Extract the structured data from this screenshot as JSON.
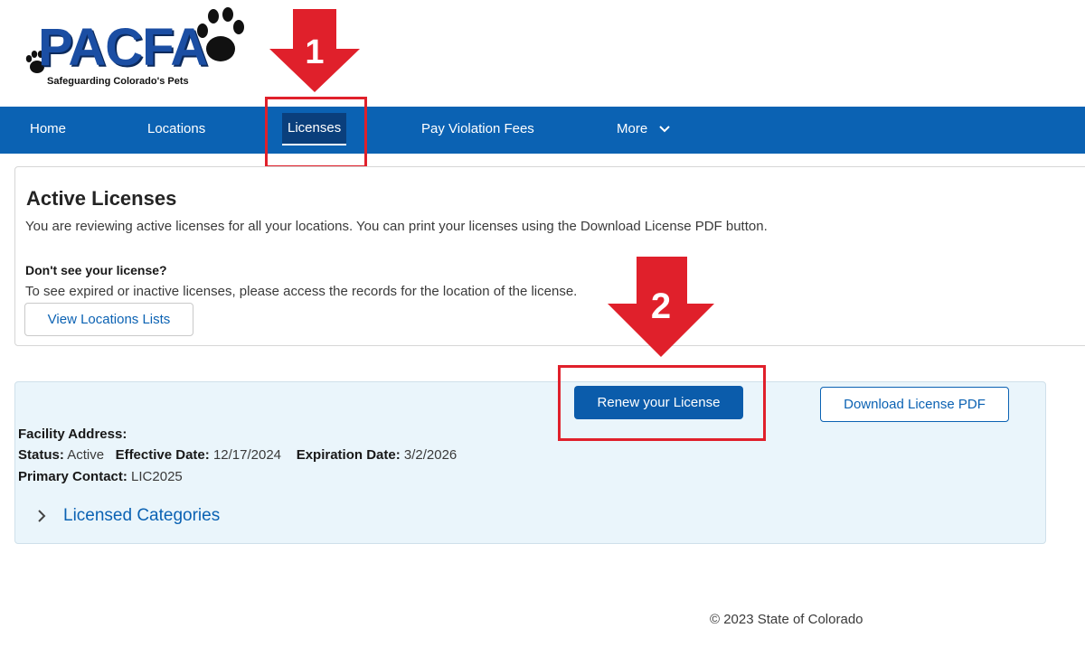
{
  "logo": {
    "text": "PACFA",
    "tagline": "Safeguarding Colorado's Pets"
  },
  "annotations": {
    "step1": "1",
    "step2": "2",
    "color": "#e0202b"
  },
  "nav": {
    "items": [
      {
        "label": "Home"
      },
      {
        "label": "Locations"
      },
      {
        "label": "Licenses",
        "active": true
      },
      {
        "label": "Pay Violation Fees"
      },
      {
        "label": "More"
      }
    ],
    "background": "#0b62b3"
  },
  "active_licenses": {
    "title": "Active Licenses",
    "description": "You are reviewing active licenses for all your locations. You can print your licenses using the Download License PDF button.",
    "missing_heading": "Don't see your license?",
    "missing_text": "To see expired or inactive licenses, please access the records for the location of the license.",
    "view_locations_button": "View Locations Lists"
  },
  "license_record": {
    "renew_button": "Renew your License",
    "download_button": "Download License PDF",
    "facility_address_label": "Facility Address:",
    "status_label": "Status:",
    "status_value": "Active",
    "effective_label": "Effective Date:",
    "effective_value": "12/17/2024",
    "expiration_label": "Expiration Date:",
    "expiration_value": "3/2/2026",
    "primary_contact_label": "Primary Contact:",
    "primary_contact_value": "LIC2025",
    "categories_label": "Licensed Categories"
  },
  "footer": {
    "copyright": "© 2023 State of Colorado"
  }
}
